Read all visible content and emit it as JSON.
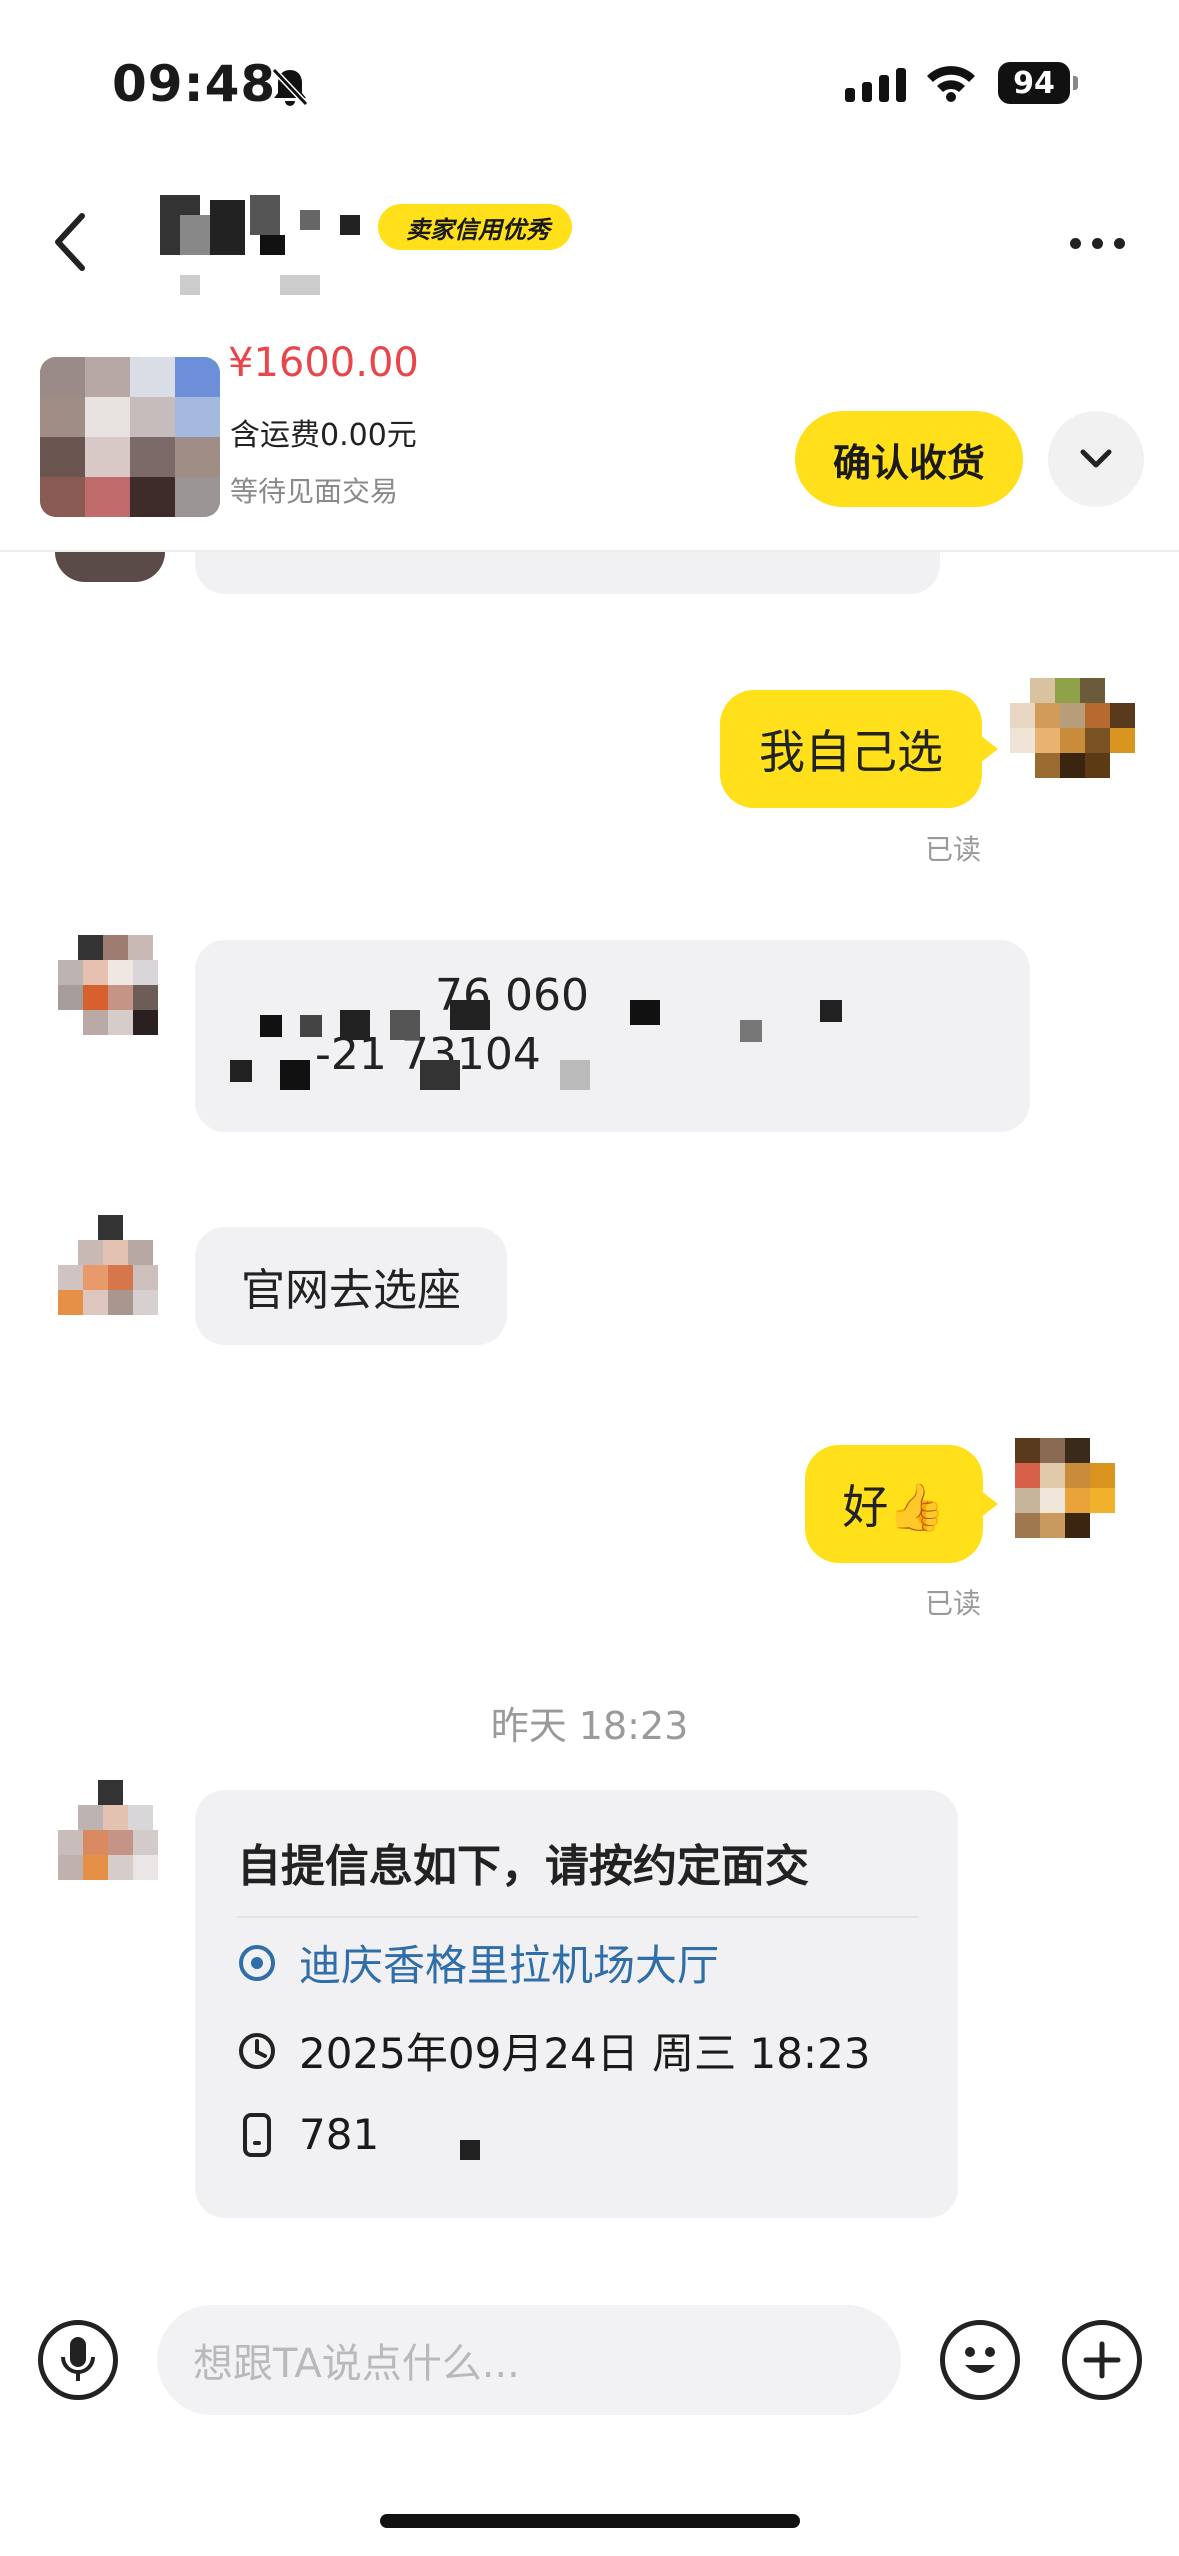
{
  "status_bar": {
    "time": "09:48",
    "battery": "94"
  },
  "header": {
    "badge": "卖家信用优秀"
  },
  "order": {
    "price": "¥1600.00",
    "shipping": "含运费0.00元",
    "status": "等待见面交易",
    "confirm_label": "确认收货"
  },
  "messages": {
    "m1": "我自己选",
    "m1_read": "已读",
    "m2_line1": "76  060",
    "m2_line2": "-21  73104",
    "m3": "官网去选座",
    "m4": "好👍",
    "m4_read": "已读"
  },
  "timestamp": "昨天 18:23",
  "pickup_card": {
    "title": "自提信息如下，请按约定面交",
    "location": "迪庆香格里拉机场大厅",
    "datetime": "2025年09月24日 周三 18:23",
    "phone": "781"
  },
  "input": {
    "placeholder": "想跟TA说点什么..."
  },
  "colors": {
    "accent": "#ffe01b",
    "price": "#e8464a",
    "link": "#2f6ea8"
  },
  "icons": [
    "bell-slash-icon",
    "signal-icon",
    "wifi-icon",
    "battery-icon",
    "back-icon",
    "more-icon",
    "chevron-down-icon",
    "location-pin-icon",
    "clock-icon",
    "phone-icon",
    "microphone-icon",
    "emoji-icon",
    "plus-icon"
  ]
}
